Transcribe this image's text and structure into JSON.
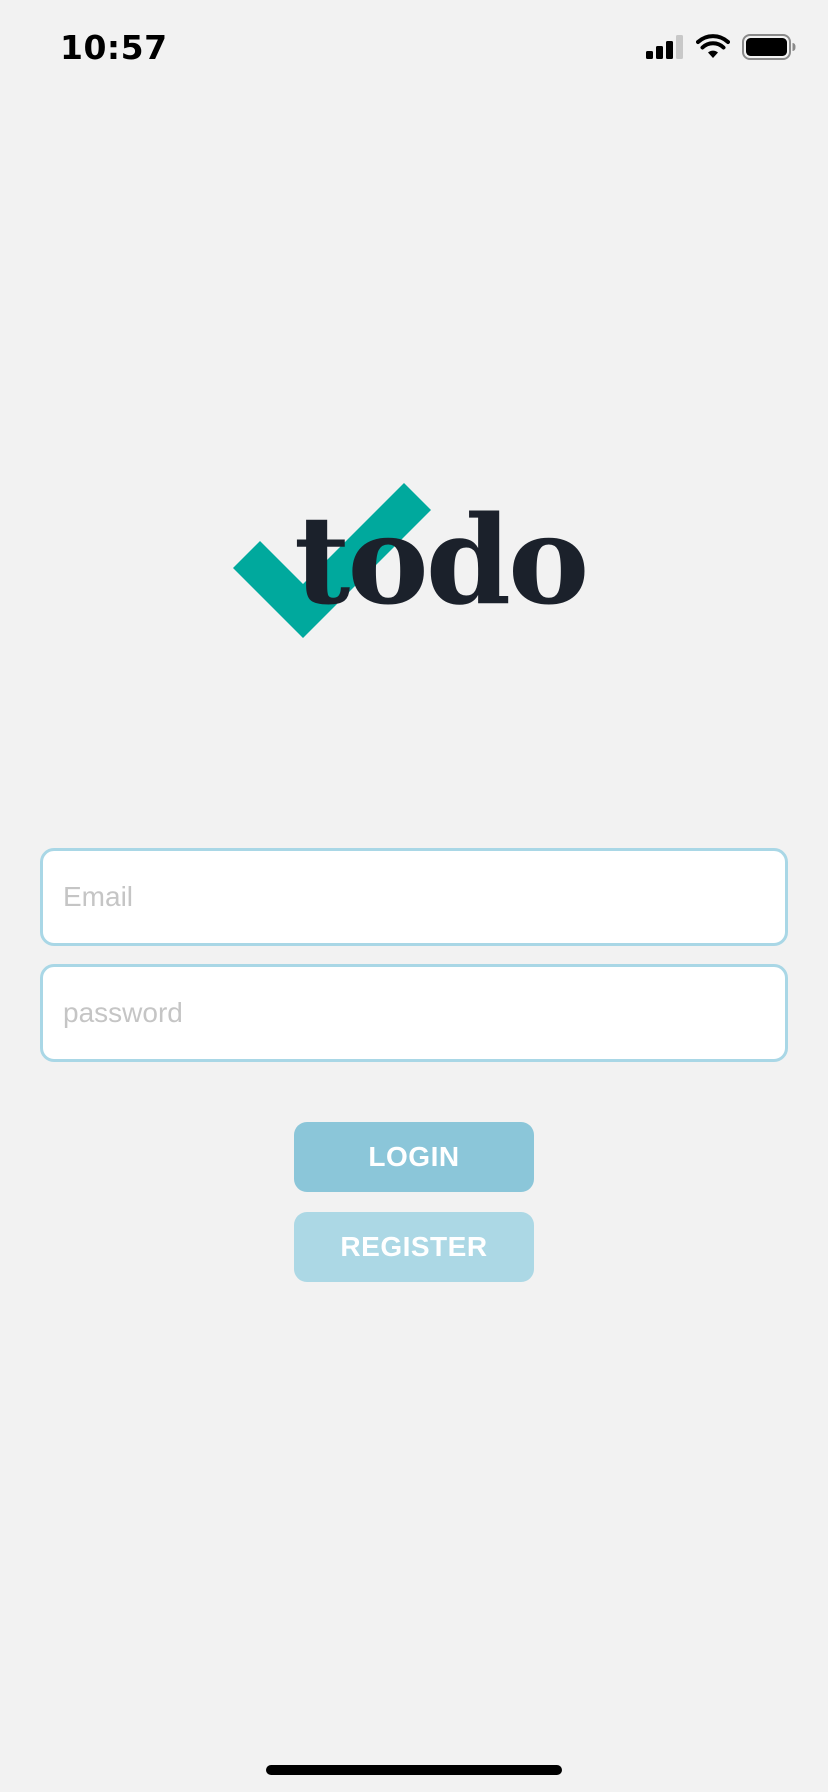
{
  "status_bar": {
    "time": "10:57",
    "icons": [
      "cellular-signal-icon",
      "wifi-icon",
      "battery-icon"
    ]
  },
  "logo": {
    "text": "todo",
    "check_color": "#00a99d",
    "text_color": "#1b212b"
  },
  "form": {
    "email_placeholder": "Email",
    "email_value": "",
    "password_placeholder": "password",
    "password_value": ""
  },
  "buttons": {
    "login_label": "LOGIN",
    "register_label": "REGISTER"
  },
  "colors": {
    "background": "#f2f2f2",
    "field_border": "#a9d7e6",
    "login_bg": "#8bc6d9",
    "register_bg": "#acd8e5"
  }
}
